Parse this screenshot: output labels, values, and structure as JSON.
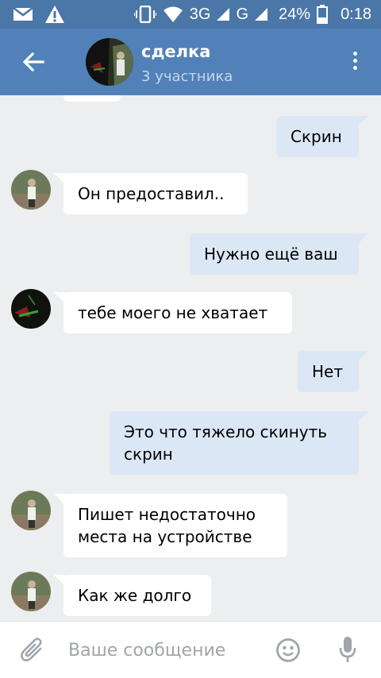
{
  "status_bar": {
    "network_3g": "3G",
    "network_g": "G",
    "battery": "24%",
    "time": "0:18",
    "icons": [
      "mail-icon",
      "warning-icon",
      "vibrate-icon",
      "wifi-icon",
      "signal-icon",
      "battery-icon"
    ]
  },
  "header": {
    "title": "сделка",
    "subtitle": "3 участника"
  },
  "messages": [
    {
      "direction": "out",
      "text": "Скрин"
    },
    {
      "direction": "in",
      "text": "Он предоставил.."
    },
    {
      "direction": "out",
      "text": "Нужно ещё ваш"
    },
    {
      "direction": "in",
      "text": "тебе моего не хватает"
    },
    {
      "direction": "out",
      "text": "Нет"
    },
    {
      "direction": "out",
      "text": "Это что тяжело скинуть скрин"
    },
    {
      "direction": "in",
      "text": "Пишет недостаточно места на устройстве"
    },
    {
      "direction": "in",
      "text": "Как же долго"
    }
  ],
  "composer": {
    "placeholder": "Ваше сообщение"
  },
  "colors": {
    "header": "#5181b8",
    "status_bar": "#4a76a8",
    "chat_background": "#edeef0",
    "incoming_bubble": "#ffffff",
    "outgoing_bubble": "#dce7f5",
    "icon_gray": "#a0a5ab"
  }
}
